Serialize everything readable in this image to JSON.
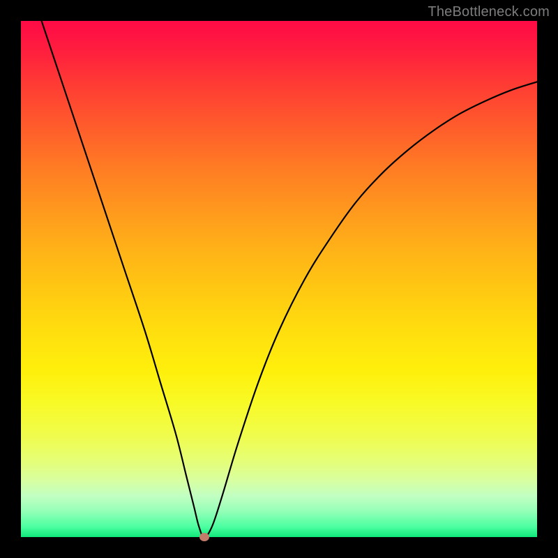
{
  "watermark": "TheBottleneck.com",
  "chart_data": {
    "type": "line",
    "title": "",
    "xlabel": "",
    "ylabel": "",
    "xlim": [
      0,
      100
    ],
    "ylim": [
      0,
      100
    ],
    "grid": false,
    "legend": false,
    "series": [
      {
        "name": "curve",
        "x": [
          4,
          8,
          12,
          16,
          20,
          24,
          27,
          30,
          32,
          33.5,
          34.5,
          35.5,
          37,
          39,
          42,
          46,
          50,
          55,
          60,
          65,
          70,
          75,
          80,
          85,
          90,
          95,
          100
        ],
        "y": [
          100,
          88,
          76,
          64,
          52,
          40,
          30,
          20,
          12,
          6,
          2,
          0,
          2,
          8,
          18,
          30,
          40,
          50,
          58,
          65,
          70.5,
          75,
          78.8,
          82,
          84.5,
          86.6,
          88.2
        ]
      }
    ],
    "marker": {
      "x": 35.5,
      "y": 0,
      "color": "#c47b6a"
    }
  }
}
